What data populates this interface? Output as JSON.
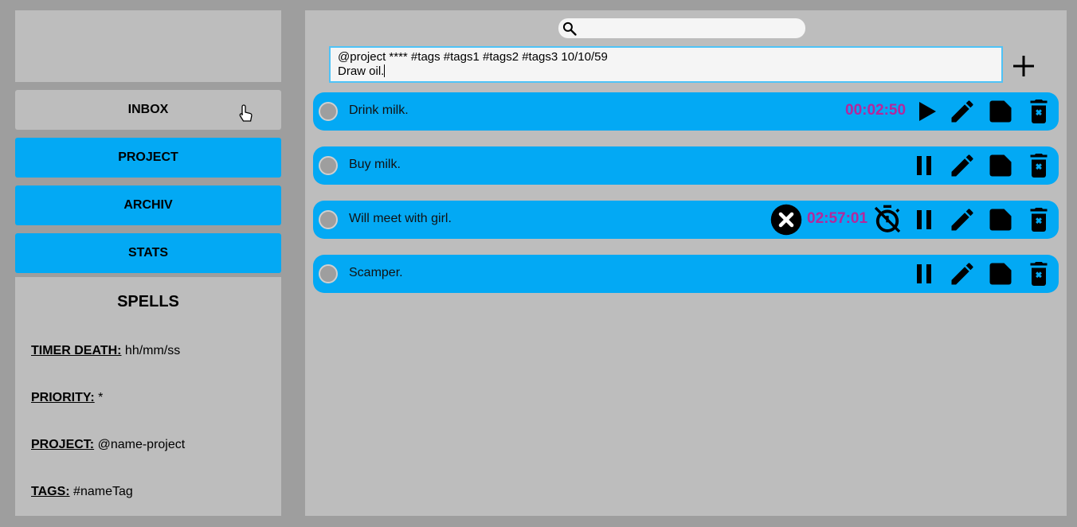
{
  "sidebar": {
    "nav": [
      {
        "label": "INBOX"
      },
      {
        "label": "PROJECT"
      },
      {
        "label": "ARCHIV"
      },
      {
        "label": "STATS"
      }
    ],
    "spells": {
      "title": "SPELLS",
      "rows": [
        {
          "key": "TIMER DEATH:",
          "value": "hh/mm/ss"
        },
        {
          "key": "PRIORITY:",
          "value": "*"
        },
        {
          "key": "PROJECT:",
          "value": "@name-project"
        },
        {
          "key": "TAGS:",
          "value": "#nameTag"
        }
      ]
    }
  },
  "main": {
    "entry": {
      "line1": "@project **** #tags #tags1 #tags2 #tags3 10/10/59",
      "line2": "Draw oil."
    },
    "tasks": [
      {
        "title": "Drink milk.",
        "timer": "00:02:50"
      },
      {
        "title": "Buy milk."
      },
      {
        "title": "Will meet with girl.",
        "timer": "02:57:01"
      },
      {
        "title": "Scamper."
      }
    ]
  },
  "colors": {
    "accent": "#03a9f4",
    "timer": "#b5279c",
    "panel": "#bdbdbd",
    "background": "#9e9e9e"
  },
  "icons": [
    "search-icon",
    "plus-icon",
    "play-icon",
    "pause-icon",
    "edit-icon",
    "note-icon",
    "delete-icon",
    "cancel-icon",
    "timer-off-icon",
    "hand-cursor-icon"
  ]
}
